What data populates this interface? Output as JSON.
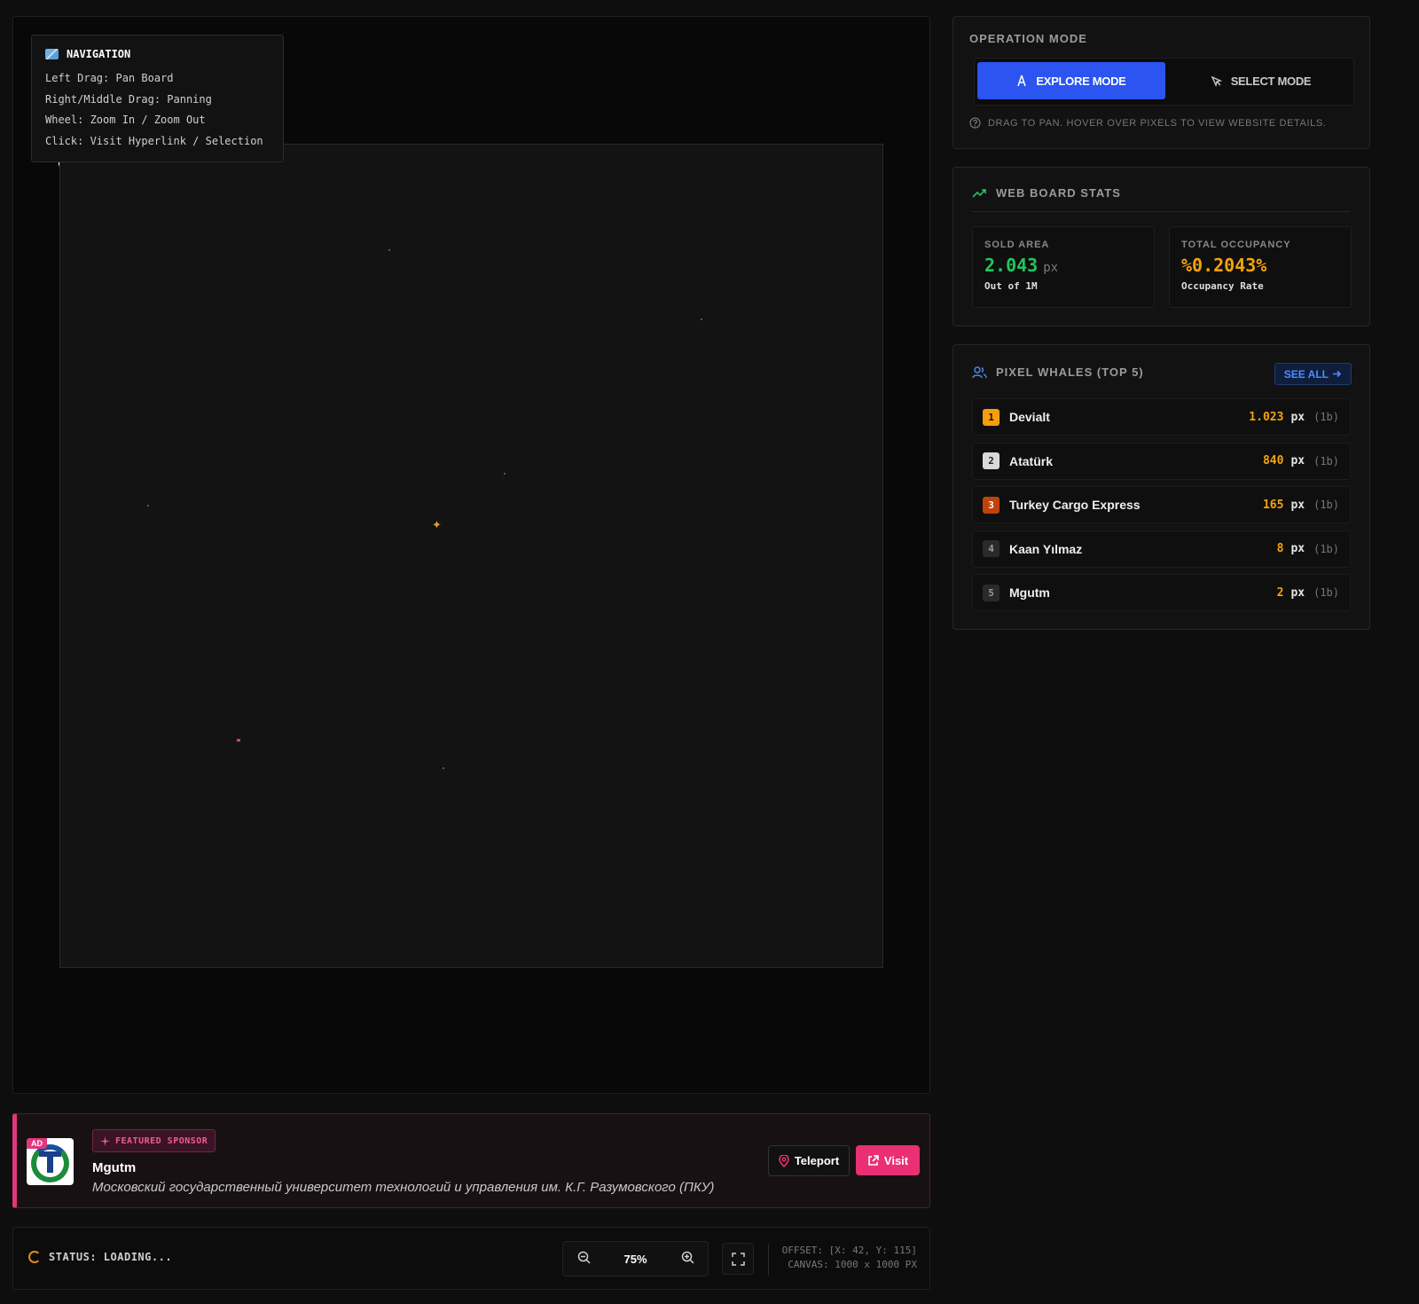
{
  "navigation": {
    "title": "NAVIGATION",
    "lines": [
      "Left Drag: Pan Board",
      "Right/Middle Drag: Panning",
      "Wheel: Zoom In / Zoom Out",
      "Click: Visit Hyperlink / Selection"
    ]
  },
  "sponsor": {
    "ad_label": "AD",
    "tag": "FEATURED SPONSOR",
    "name": "Mgutm",
    "description": "Московский государственный университет технологий и управления им. К.Г. Разумовского (ПКУ)",
    "teleport_label": "Teleport",
    "visit_label": "Visit"
  },
  "status": {
    "text": "STATUS: LOADING...",
    "zoom": "75%",
    "offset": "OFFSET: [X: 42, Y: 115]",
    "canvas": "CANVAS: 1000 x 1000 PX"
  },
  "operation": {
    "title": "OPERATION MODE",
    "explore_label": "EXPLORE MODE",
    "select_label": "SELECT MODE",
    "active_mode": "explore",
    "hint": "DRAG TO PAN. HOVER OVER PIXELS TO VIEW WEBSITE DETAILS."
  },
  "stats": {
    "title": "WEB BOARD STATS",
    "sold_area": {
      "label": "SOLD AREA",
      "value": "2.043",
      "unit": "px",
      "sub": "Out of 1M"
    },
    "occupancy": {
      "label": "TOTAL OCCUPANCY",
      "value": "%0.2043%",
      "sub": "Occupancy Rate"
    }
  },
  "whales": {
    "title": "PIXEL WHALES (TOP 5)",
    "see_all": "SEE ALL",
    "items": [
      {
        "rank": "1",
        "name": "Devialt",
        "amount": "1.023",
        "unit": "px",
        "blocks": "(1b)"
      },
      {
        "rank": "2",
        "name": "Atatürk",
        "amount": "840",
        "unit": "px",
        "blocks": "(1b)"
      },
      {
        "rank": "3",
        "name": "Turkey Cargo Express",
        "amount": "165",
        "unit": "px",
        "blocks": "(1b)"
      },
      {
        "rank": "4",
        "name": "Kaan Yılmaz",
        "amount": "8",
        "unit": "px",
        "blocks": "(1b)"
      },
      {
        "rank": "5",
        "name": "Mgutm",
        "amount": "2",
        "unit": "px",
        "blocks": "(1b)"
      }
    ]
  },
  "colors": {
    "accent_blue": "#2b54f0",
    "sold_green": "#22c55e",
    "occupancy_orange": "#f5a30b",
    "sponsor_pink": "#ea2f73"
  }
}
